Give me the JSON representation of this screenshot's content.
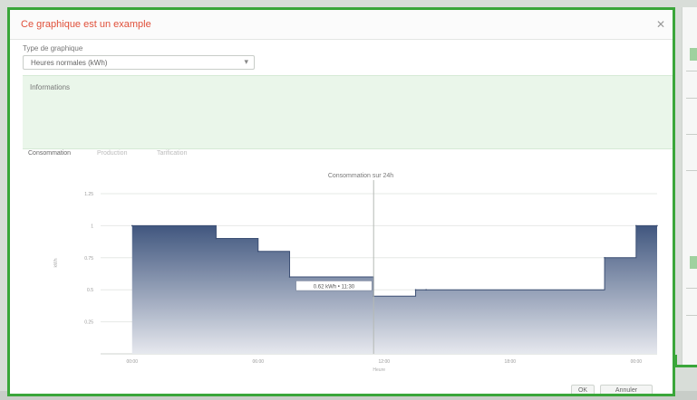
{
  "modal": {
    "title": "Ce graphique est un example",
    "close_icon": "close-icon"
  },
  "selector": {
    "label": "Type de graphique",
    "value": "Heures normales (kWh)"
  },
  "info": {
    "title": "Informations"
  },
  "tabs": [
    {
      "label": "Consommation",
      "active": true
    },
    {
      "label": "Production",
      "active": false
    },
    {
      "label": "Tarification",
      "active": false
    }
  ],
  "colors": {
    "accent_green": "#3aa63a",
    "title_red": "#e0503a",
    "series_top": "#41577f",
    "series_bottom": "#e6e8ee",
    "info_bg": "#eaf6ea"
  },
  "chart_data": {
    "type": "area",
    "step": true,
    "title": "Consommation sur 24h",
    "xlabel": "Heure",
    "ylabel": "kWh",
    "ylim": [
      0,
      1.25
    ],
    "yticks": [
      0.25,
      0.5,
      0.75,
      1,
      1.25
    ],
    "ytick_labels": [
      "0.25",
      "0.5",
      "0.75",
      "1",
      "1.25"
    ],
    "xlim": [
      -1.5,
      25
    ],
    "xticks": [
      0,
      6,
      12,
      18,
      24
    ],
    "xtick_labels": [
      "00:00",
      "06:00",
      "12:00",
      "18:00",
      "00:00"
    ],
    "grid": true,
    "cursor_x": 11.5,
    "tooltip": "0.62 kWh • 11:30",
    "series": [
      {
        "x": [
          0,
          4,
          6,
          7.5,
          11.5,
          13.5,
          14,
          22.5,
          24,
          25
        ],
        "y": [
          1,
          0.9,
          0.8,
          0.6,
          0.45,
          0.5,
          0.5,
          0.75,
          1,
          1
        ]
      }
    ]
  },
  "footer": {
    "ok_label": "OK",
    "cancel_label": "Annuler"
  }
}
